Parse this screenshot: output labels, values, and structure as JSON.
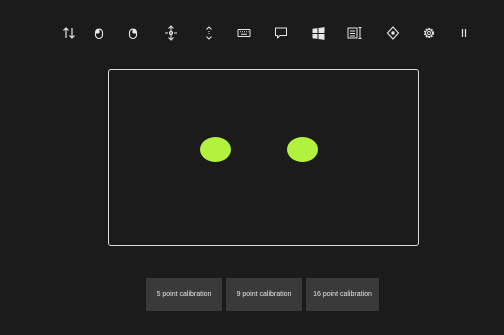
{
  "toolbar": {
    "icons": [
      "swap-vertical-icon",
      "mouse-left-click-icon",
      "mouse-right-click-icon",
      "scroll-icon",
      "expand-vertical-icon",
      "keyboard-icon",
      "chat-bubble-icon",
      "windows-logo-icon",
      "cursor-text-icon",
      "gaze-target-icon",
      "settings-gear-icon",
      "pause-icon"
    ]
  },
  "calibration": {
    "buttons": [
      {
        "label": "5 point calibration"
      },
      {
        "label": "9 point calibration"
      },
      {
        "label": "16 point calibration"
      }
    ]
  },
  "colors": {
    "background": "#1b1b1b",
    "frame_border": "#dcdcdc",
    "gaze_dot": "#b3f23c",
    "button_bg": "#3a3a3a",
    "icon": "#e6e6e6"
  }
}
